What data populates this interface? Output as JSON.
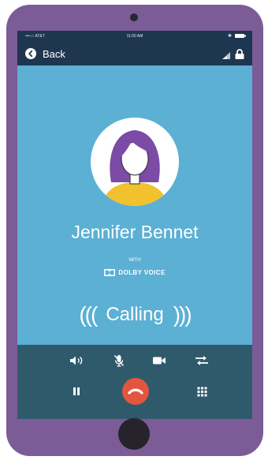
{
  "status_bar": {
    "carrier": "•••○○ AT&T",
    "time": "11:00 AM",
    "bluetooth": "✱"
  },
  "nav": {
    "back_label": "Back",
    "icons": [
      "signal-icon",
      "lock-icon"
    ]
  },
  "call": {
    "caller_name": "Jennifer Bennet",
    "with_text": "WITH",
    "codec_brand": "DOLBY VOICE",
    "status": "Calling",
    "waves_left": "(((",
    "waves_right": ")))"
  },
  "controls": {
    "row1": [
      "speaker-icon",
      "mute-icon",
      "video-icon",
      "switch-icon"
    ],
    "row2": [
      "hold-icon",
      "end-call-icon",
      "keypad-icon"
    ]
  },
  "colors": {
    "phone_body": "#7b5c96",
    "screen_bg": "#5bb0d4",
    "nav_bg": "#1f3650",
    "controls_bg": "#2f5a6b",
    "end_call": "#e2553f",
    "avatar_hair": "#7b4ba6",
    "avatar_shirt": "#f2c12e"
  }
}
